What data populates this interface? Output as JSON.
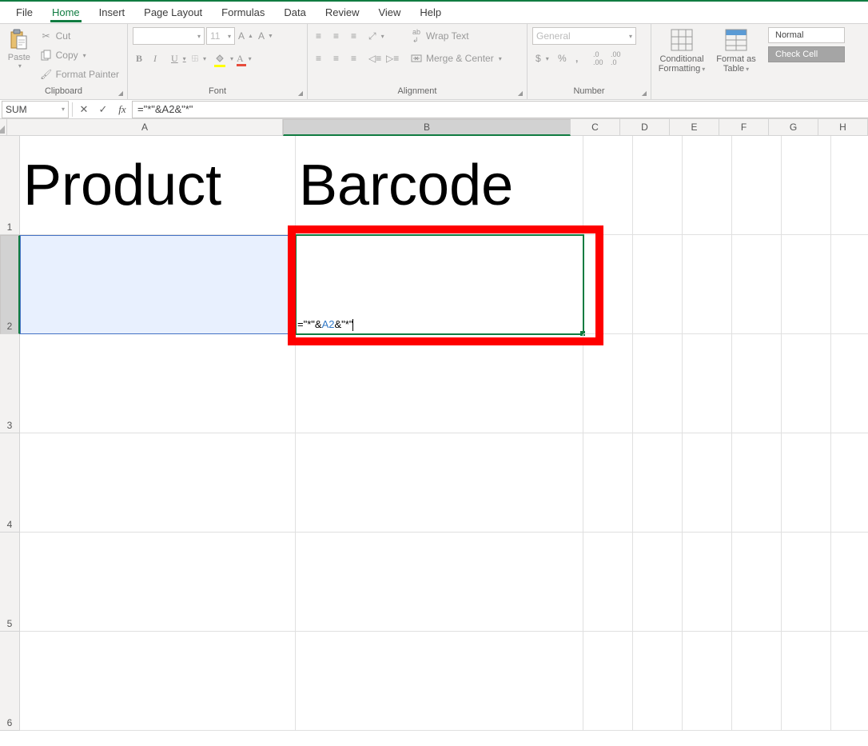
{
  "tabs": [
    "File",
    "Home",
    "Insert",
    "Page Layout",
    "Formulas",
    "Data",
    "Review",
    "View",
    "Help"
  ],
  "active_tab": 1,
  "clipboard": {
    "cut": "Cut",
    "copy": "Copy",
    "fp": "Format Painter",
    "paste": "Paste",
    "label": "Clipboard"
  },
  "font": {
    "name": "",
    "size": "11",
    "label": "Font"
  },
  "alignment": {
    "wrap": "Wrap Text",
    "merge": "Merge & Center",
    "label": "Alignment"
  },
  "number": {
    "fmt": "General",
    "label": "Number"
  },
  "stylesg": {
    "cf": "Conditional Formatting",
    "ft": "Format as Table",
    "normal": "Normal",
    "check": "Check Cell"
  },
  "namebox": "SUM",
  "formula_text": "=\"*\"&A2&\"*\"",
  "formula_parts": {
    "p1": "=\"*\"&",
    "ref": "A2",
    "p2": "&\"*\""
  },
  "headers": {
    "A": "Product",
    "B": "Barcode"
  },
  "cols": [
    "A",
    "B",
    "C",
    "D",
    "E",
    "F",
    "G",
    "H"
  ],
  "rows": [
    "1",
    "2",
    "3",
    "4",
    "5",
    "6"
  ],
  "colw": {
    "A": 345,
    "B": 360,
    "narrow": 62
  },
  "rowh": {
    "tall": 124,
    "short": 126
  }
}
